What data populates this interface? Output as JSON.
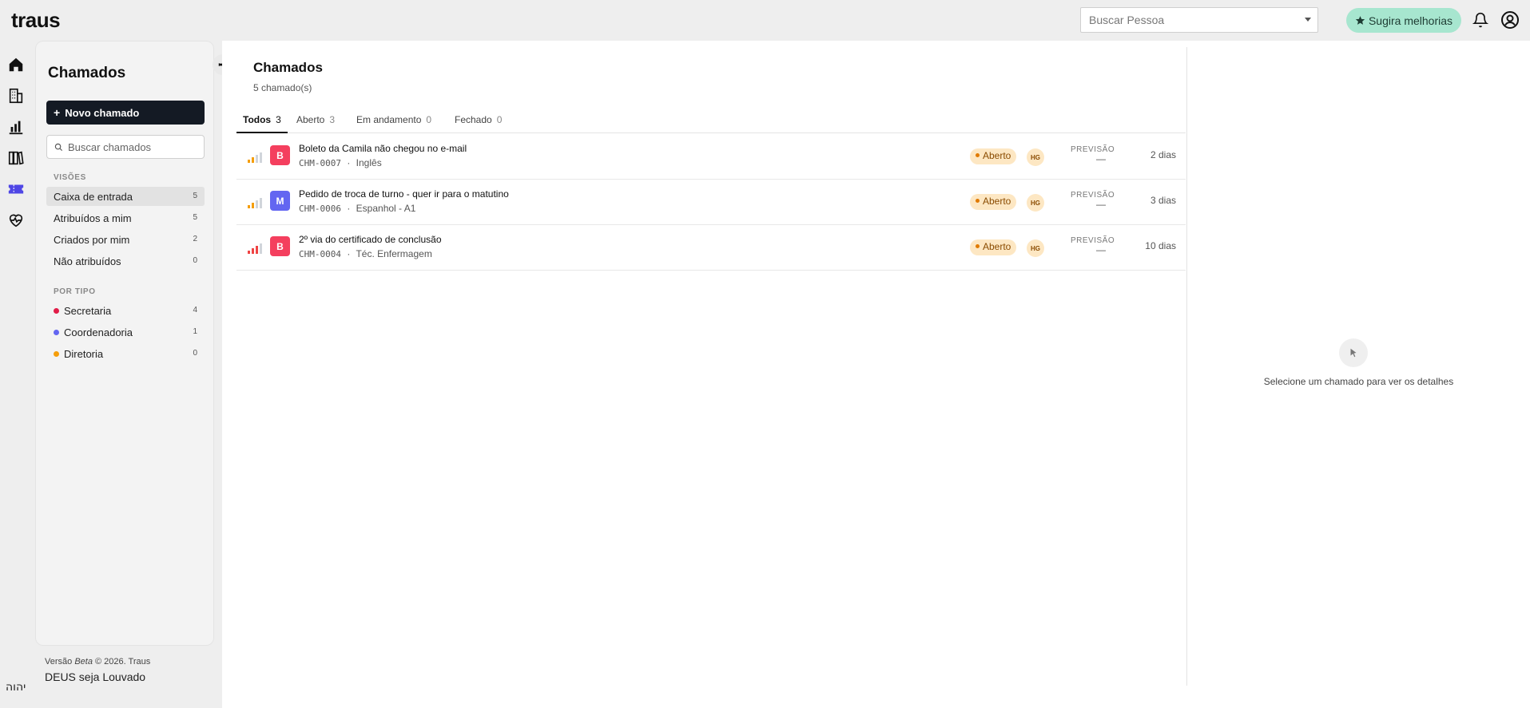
{
  "app": {
    "logo": "traus"
  },
  "topbar": {
    "person_search_placeholder": "Buscar Pessoa",
    "suggest_label": "Sugira melhorias"
  },
  "rail": [
    {
      "icon": "home-icon"
    },
    {
      "icon": "building-icon"
    },
    {
      "icon": "bar-chart-icon"
    },
    {
      "icon": "books-icon"
    },
    {
      "icon": "ticket-icon",
      "active": true
    },
    {
      "icon": "heart-pulse-icon"
    }
  ],
  "sidebar": {
    "title": "Chamados",
    "new_button": "Novo chamado",
    "search_placeholder": "Buscar chamados",
    "views_label": "VISÕES",
    "views": [
      {
        "label": "Caixa de entrada",
        "count": "5",
        "active": true
      },
      {
        "label": "Atribuídos a mim",
        "count": "5"
      },
      {
        "label": "Criados por mim",
        "count": "2"
      },
      {
        "label": "Não atribuídos",
        "count": "0"
      }
    ],
    "types_label": "POR TIPO",
    "types": [
      {
        "label": "Secretaria",
        "count": "4",
        "color": "#e11d48"
      },
      {
        "label": "Coordenadoria",
        "count": "1",
        "color": "#6366f1"
      },
      {
        "label": "Diretoria",
        "count": "0",
        "color": "#f59e0b"
      }
    ]
  },
  "footer": {
    "version_prefix": "Versão",
    "version_beta": "Beta",
    "version_suffix": "© 2026. Traus",
    "line2": "DEUS seja Louvado",
    "yhwh": "יהוה"
  },
  "main": {
    "title": "Chamados",
    "subtitle": "5 chamado(s)",
    "tabs": [
      {
        "label": "Todos",
        "count": "3",
        "active": true
      },
      {
        "label": "Aberto",
        "count": "3"
      },
      {
        "label": "Em andamento",
        "count": "0"
      },
      {
        "label": "Fechado",
        "count": "0"
      }
    ],
    "tickets": [
      {
        "letter": "B",
        "color": "#f43f5e",
        "title": "Boleto da Camila não chegou no e-mail",
        "code": "CHM-0007",
        "sep": "·",
        "category": "Inglês",
        "status": "Aberto",
        "assignee": "HG",
        "forecast_label": "PREVISÃO",
        "forecast": "—",
        "age": "2 dias"
      },
      {
        "letter": "M",
        "color": "#6366f1",
        "title": "Pedido de troca de turno - quer ir para o matutino",
        "code": "CHM-0006",
        "sep": "·",
        "category": "Espanhol - A1",
        "status": "Aberto",
        "assignee": "HG",
        "forecast_label": "PREVISÃO",
        "forecast": "—",
        "age": "3 dias"
      },
      {
        "letter": "B",
        "color": "#f43f5e",
        "title": "2º via do certificado de conclusão",
        "code": "CHM-0004",
        "sep": "·",
        "category": "Téc. Enfermagem",
        "status": "Aberto",
        "assignee": "HG",
        "forecast_label": "PREVISÃO",
        "forecast": "—",
        "age": "10 dias"
      }
    ],
    "detail_empty": "Selecione um chamado para ver os detalhes"
  }
}
